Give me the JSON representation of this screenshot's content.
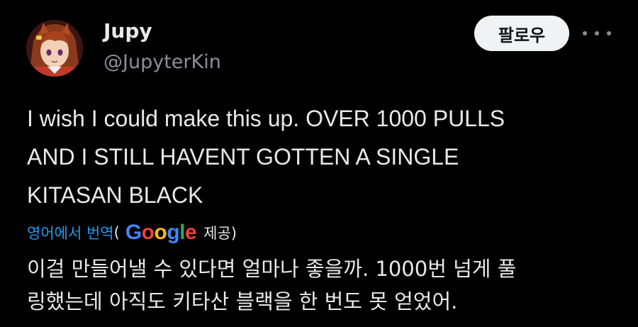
{
  "author": {
    "display_name": "Jupy",
    "handle": "@JupyterKin",
    "avatar_icon": "anime-girl-avatar"
  },
  "actions": {
    "follow_label": "팔로우",
    "more_icon": "more-horizontal-icon"
  },
  "tweet": {
    "lines": [
      "I wish I could make this up. OVER 1000 PULLS",
      "AND I STILL HAVENT GOTTEN A SINGLE",
      "KITASAN BLACK"
    ]
  },
  "translation": {
    "link_label": "영어에서 번역",
    "open_paren": "(",
    "logo_text": [
      "G",
      "o",
      "o",
      "g",
      "l",
      "e"
    ],
    "provided_label": "제공)",
    "lines": [
      "이걸 만들어낼 수 있다면 얼마나 좋을까. 1000번 넘게 풀",
      "링했는데 아직도 키타산 블랙을 한 번도 못 얻었어."
    ]
  },
  "colors": {
    "background": "#000000",
    "text": "#e7e9ea",
    "secondary_text": "#8b9096",
    "link": "#1d9bf0",
    "follow_bg": "#eff3f4"
  }
}
